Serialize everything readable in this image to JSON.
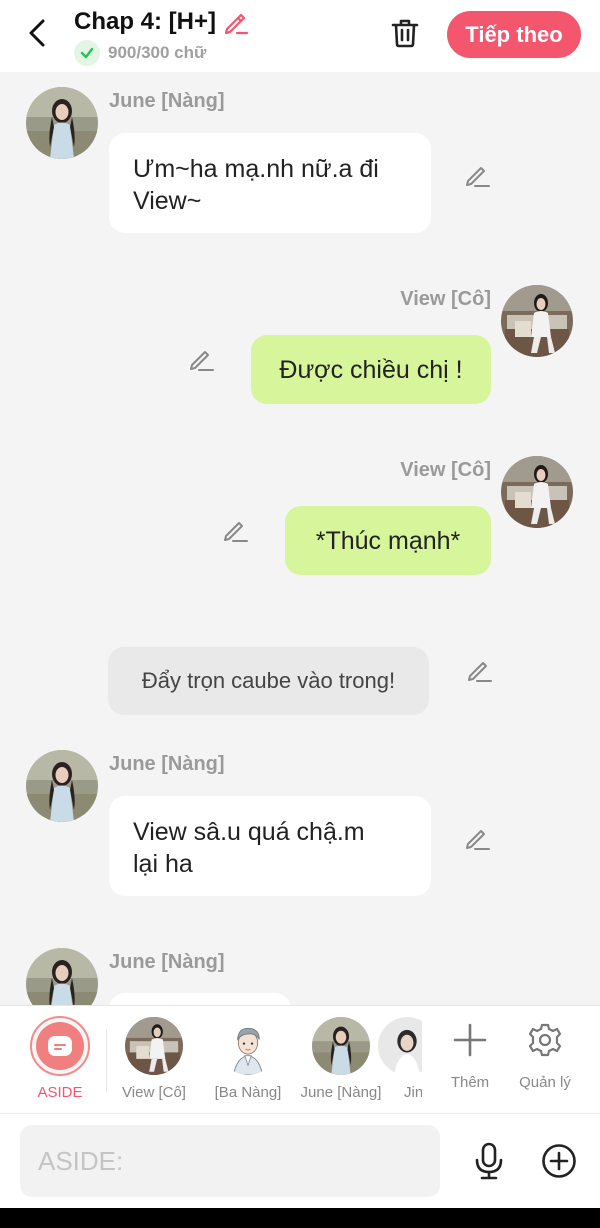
{
  "header": {
    "title": "Chap 4: [H+]",
    "word_count": "900/300 chữ",
    "next_label": "Tiếp theo",
    "accent_color": "#f4566d"
  },
  "messages": [
    {
      "side": "left",
      "name": "June [Nàng]",
      "text_line1": "Ưm~ha mạ.nh nữ.a đi",
      "text_line2": "View~"
    },
    {
      "side": "right",
      "name": "View [Cô]",
      "text": "Được chiều chị !"
    },
    {
      "side": "right",
      "name": "View [Cô]",
      "text": "*Thúc mạnh*"
    },
    {
      "side": "aside",
      "text": "Đẩy trọn caube vào trong!"
    },
    {
      "side": "left",
      "name": "June [Nàng]",
      "text_line1": "View sâ.u quá chậ.m",
      "text_line2": "lại ha"
    },
    {
      "side": "left",
      "name": "June [Nàng]"
    }
  ],
  "characters": [
    {
      "label": "ASIDE",
      "icon": "chat-icon",
      "selected": true
    },
    {
      "label": "View [Cô]",
      "icon": "avatar"
    },
    {
      "label": "[Ba Nàng]",
      "icon": "avatar"
    },
    {
      "label": "June [Nàng]",
      "icon": "avatar"
    },
    {
      "label": "Jin",
      "icon": "avatar"
    }
  ],
  "tools": [
    {
      "label": "Thêm",
      "icon": "plus-icon"
    },
    {
      "label": "Quản lý",
      "icon": "gear-icon"
    }
  ],
  "composer": {
    "placeholder": "ASIDE:"
  },
  "colors": {
    "right_bubble": "#d7f59a",
    "left_bubble": "#ffffff",
    "aside_bubble": "#e9e9e9",
    "selected_label": "#f4566d"
  }
}
